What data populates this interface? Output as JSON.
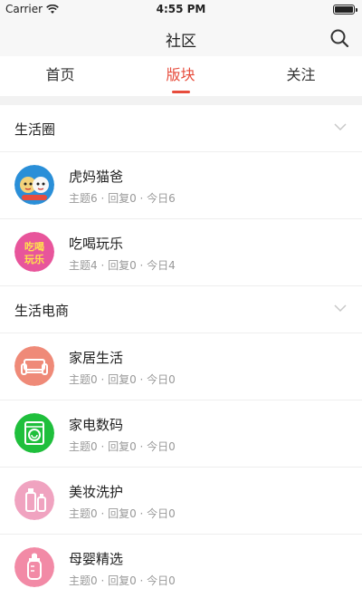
{
  "status": {
    "carrier": "Carrier",
    "time": "4:55 PM"
  },
  "nav": {
    "title": "社区",
    "search_icon": "search-icon"
  },
  "tabs": [
    {
      "label": "首页",
      "active": false
    },
    {
      "label": "版块",
      "active": true
    },
    {
      "label": "关注",
      "active": false
    }
  ],
  "accent_color": "#e74c3c",
  "sections": [
    {
      "title": "生活圈",
      "items": [
        {
          "name": "虎妈猫爸",
          "meta": "主题6 · 回复0 · 今日6"
        },
        {
          "name": "吃喝玩乐",
          "meta": "主题4 · 回复0 · 今日4",
          "avatar_text": [
            "吃喝",
            "玩乐"
          ]
        }
      ]
    },
    {
      "title": "生活电商",
      "items": [
        {
          "name": "家居生活",
          "meta": "主题0 · 回复0 · 今日0"
        },
        {
          "name": "家电数码",
          "meta": "主题0 · 回复0 · 今日0"
        },
        {
          "name": "美妆洗护",
          "meta": "主题0 · 回复0 · 今日0"
        },
        {
          "name": "母婴精选",
          "meta": "主题0 · 回复0 · 今日0"
        }
      ]
    }
  ]
}
